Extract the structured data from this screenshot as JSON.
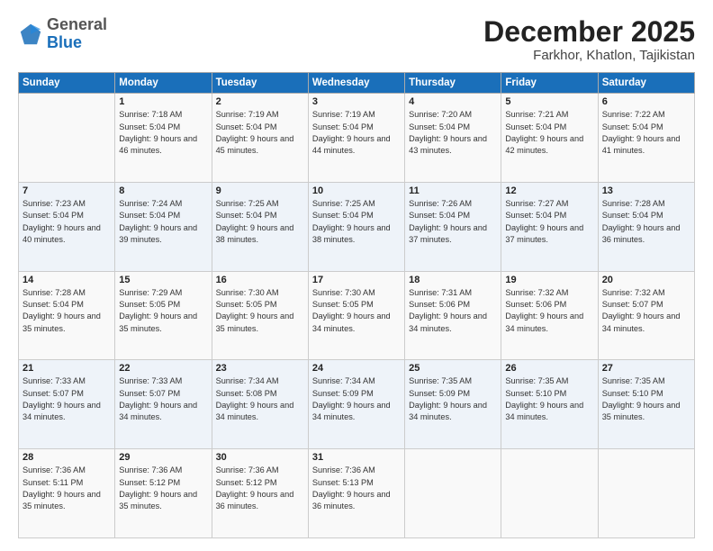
{
  "logo": {
    "general": "General",
    "blue": "Blue"
  },
  "header": {
    "month": "December 2025",
    "location": "Farkhor, Khatlon, Tajikistan"
  },
  "weekdays": [
    "Sunday",
    "Monday",
    "Tuesday",
    "Wednesday",
    "Thursday",
    "Friday",
    "Saturday"
  ],
  "weeks": [
    [
      {
        "day": "",
        "sunrise": "",
        "sunset": "",
        "daylight": ""
      },
      {
        "day": "1",
        "sunrise": "Sunrise: 7:18 AM",
        "sunset": "Sunset: 5:04 PM",
        "daylight": "Daylight: 9 hours and 46 minutes."
      },
      {
        "day": "2",
        "sunrise": "Sunrise: 7:19 AM",
        "sunset": "Sunset: 5:04 PM",
        "daylight": "Daylight: 9 hours and 45 minutes."
      },
      {
        "day": "3",
        "sunrise": "Sunrise: 7:19 AM",
        "sunset": "Sunset: 5:04 PM",
        "daylight": "Daylight: 9 hours and 44 minutes."
      },
      {
        "day": "4",
        "sunrise": "Sunrise: 7:20 AM",
        "sunset": "Sunset: 5:04 PM",
        "daylight": "Daylight: 9 hours and 43 minutes."
      },
      {
        "day": "5",
        "sunrise": "Sunrise: 7:21 AM",
        "sunset": "Sunset: 5:04 PM",
        "daylight": "Daylight: 9 hours and 42 minutes."
      },
      {
        "day": "6",
        "sunrise": "Sunrise: 7:22 AM",
        "sunset": "Sunset: 5:04 PM",
        "daylight": "Daylight: 9 hours and 41 minutes."
      }
    ],
    [
      {
        "day": "7",
        "sunrise": "Sunrise: 7:23 AM",
        "sunset": "Sunset: 5:04 PM",
        "daylight": "Daylight: 9 hours and 40 minutes."
      },
      {
        "day": "8",
        "sunrise": "Sunrise: 7:24 AM",
        "sunset": "Sunset: 5:04 PM",
        "daylight": "Daylight: 9 hours and 39 minutes."
      },
      {
        "day": "9",
        "sunrise": "Sunrise: 7:25 AM",
        "sunset": "Sunset: 5:04 PM",
        "daylight": "Daylight: 9 hours and 38 minutes."
      },
      {
        "day": "10",
        "sunrise": "Sunrise: 7:25 AM",
        "sunset": "Sunset: 5:04 PM",
        "daylight": "Daylight: 9 hours and 38 minutes."
      },
      {
        "day": "11",
        "sunrise": "Sunrise: 7:26 AM",
        "sunset": "Sunset: 5:04 PM",
        "daylight": "Daylight: 9 hours and 37 minutes."
      },
      {
        "day": "12",
        "sunrise": "Sunrise: 7:27 AM",
        "sunset": "Sunset: 5:04 PM",
        "daylight": "Daylight: 9 hours and 37 minutes."
      },
      {
        "day": "13",
        "sunrise": "Sunrise: 7:28 AM",
        "sunset": "Sunset: 5:04 PM",
        "daylight": "Daylight: 9 hours and 36 minutes."
      }
    ],
    [
      {
        "day": "14",
        "sunrise": "Sunrise: 7:28 AM",
        "sunset": "Sunset: 5:04 PM",
        "daylight": "Daylight: 9 hours and 35 minutes."
      },
      {
        "day": "15",
        "sunrise": "Sunrise: 7:29 AM",
        "sunset": "Sunset: 5:05 PM",
        "daylight": "Daylight: 9 hours and 35 minutes."
      },
      {
        "day": "16",
        "sunrise": "Sunrise: 7:30 AM",
        "sunset": "Sunset: 5:05 PM",
        "daylight": "Daylight: 9 hours and 35 minutes."
      },
      {
        "day": "17",
        "sunrise": "Sunrise: 7:30 AM",
        "sunset": "Sunset: 5:05 PM",
        "daylight": "Daylight: 9 hours and 34 minutes."
      },
      {
        "day": "18",
        "sunrise": "Sunrise: 7:31 AM",
        "sunset": "Sunset: 5:06 PM",
        "daylight": "Daylight: 9 hours and 34 minutes."
      },
      {
        "day": "19",
        "sunrise": "Sunrise: 7:32 AM",
        "sunset": "Sunset: 5:06 PM",
        "daylight": "Daylight: 9 hours and 34 minutes."
      },
      {
        "day": "20",
        "sunrise": "Sunrise: 7:32 AM",
        "sunset": "Sunset: 5:07 PM",
        "daylight": "Daylight: 9 hours and 34 minutes."
      }
    ],
    [
      {
        "day": "21",
        "sunrise": "Sunrise: 7:33 AM",
        "sunset": "Sunset: 5:07 PM",
        "daylight": "Daylight: 9 hours and 34 minutes."
      },
      {
        "day": "22",
        "sunrise": "Sunrise: 7:33 AM",
        "sunset": "Sunset: 5:07 PM",
        "daylight": "Daylight: 9 hours and 34 minutes."
      },
      {
        "day": "23",
        "sunrise": "Sunrise: 7:34 AM",
        "sunset": "Sunset: 5:08 PM",
        "daylight": "Daylight: 9 hours and 34 minutes."
      },
      {
        "day": "24",
        "sunrise": "Sunrise: 7:34 AM",
        "sunset": "Sunset: 5:09 PM",
        "daylight": "Daylight: 9 hours and 34 minutes."
      },
      {
        "day": "25",
        "sunrise": "Sunrise: 7:35 AM",
        "sunset": "Sunset: 5:09 PM",
        "daylight": "Daylight: 9 hours and 34 minutes."
      },
      {
        "day": "26",
        "sunrise": "Sunrise: 7:35 AM",
        "sunset": "Sunset: 5:10 PM",
        "daylight": "Daylight: 9 hours and 34 minutes."
      },
      {
        "day": "27",
        "sunrise": "Sunrise: 7:35 AM",
        "sunset": "Sunset: 5:10 PM",
        "daylight": "Daylight: 9 hours and 35 minutes."
      }
    ],
    [
      {
        "day": "28",
        "sunrise": "Sunrise: 7:36 AM",
        "sunset": "Sunset: 5:11 PM",
        "daylight": "Daylight: 9 hours and 35 minutes."
      },
      {
        "day": "29",
        "sunrise": "Sunrise: 7:36 AM",
        "sunset": "Sunset: 5:12 PM",
        "daylight": "Daylight: 9 hours and 35 minutes."
      },
      {
        "day": "30",
        "sunrise": "Sunrise: 7:36 AM",
        "sunset": "Sunset: 5:12 PM",
        "daylight": "Daylight: 9 hours and 36 minutes."
      },
      {
        "day": "31",
        "sunrise": "Sunrise: 7:36 AM",
        "sunset": "Sunset: 5:13 PM",
        "daylight": "Daylight: 9 hours and 36 minutes."
      },
      {
        "day": "",
        "sunrise": "",
        "sunset": "",
        "daylight": ""
      },
      {
        "day": "",
        "sunrise": "",
        "sunset": "",
        "daylight": ""
      },
      {
        "day": "",
        "sunrise": "",
        "sunset": "",
        "daylight": ""
      }
    ]
  ]
}
